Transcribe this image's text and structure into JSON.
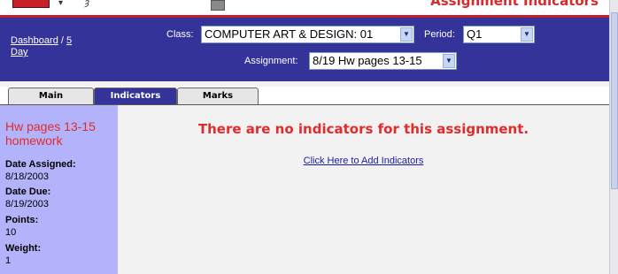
{
  "header": {
    "page_title": "Assignment Indicators",
    "breadcrumb_dashboard": "Dashboard",
    "breadcrumb_sep": " / ",
    "breadcrumb_days": "5 Day",
    "class_label": "Class:",
    "class_value": "COMPUTER ART & DESIGN: 01",
    "period_label": "Period:",
    "period_value": "Q1",
    "assignment_label": "Assignment:",
    "assignment_value": "8/19 Hw pages 13-15"
  },
  "tabs": [
    {
      "label": "Main",
      "active": false
    },
    {
      "label": "Indicators",
      "active": true
    },
    {
      "label": "Marks",
      "active": false
    }
  ],
  "sidebar": {
    "assignment_name": "Hw pages 13-15 homework",
    "date_assigned_label": "Date Assigned:",
    "date_assigned_value": "8/18/2003",
    "date_due_label": "Date Due:",
    "date_due_value": "8/19/2003",
    "points_label": "Points:",
    "points_value": "10",
    "weight_label": "Weight:",
    "weight_value": "1"
  },
  "main": {
    "message": "There are no indicators for this assignment.",
    "add_link": "Click Here to Add Indicators"
  },
  "icons": {
    "dropdown_arrow": "chevron-down-icon",
    "print": "print-icon"
  },
  "colors": {
    "header_blue": "#33339a",
    "accent_red": "#c41e2e",
    "sidebar_lavender": "#b3b3fb",
    "message_red": "#e22b2b"
  }
}
